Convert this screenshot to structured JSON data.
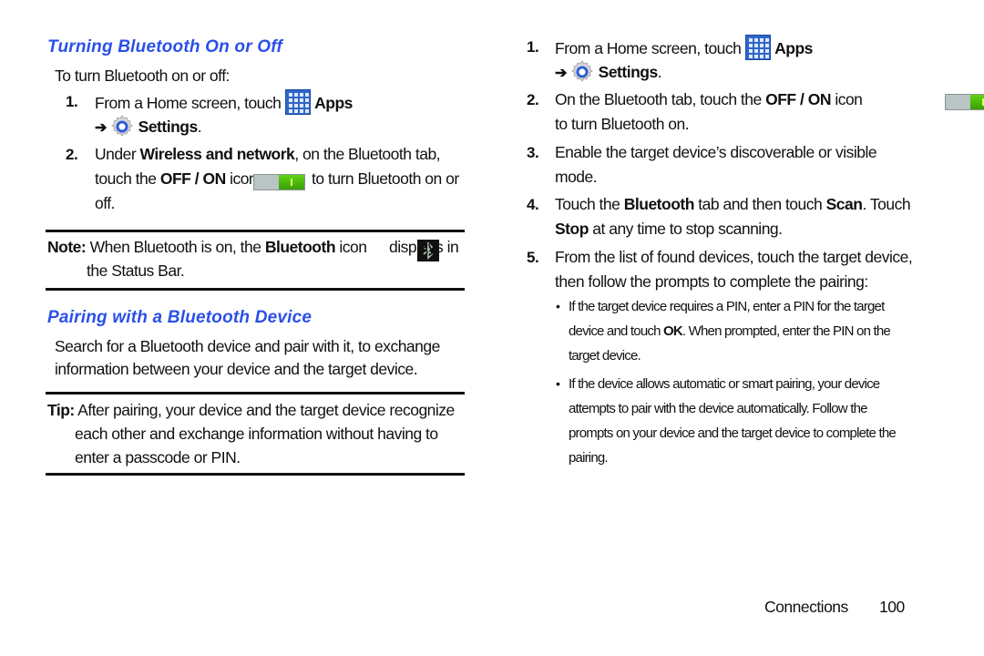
{
  "left": {
    "section1": {
      "title": "Turning Bluetooth On or Off",
      "intro": "To turn Bluetooth on or off:",
      "step1": {
        "num": "1.",
        "text_a": "From a Home screen, touch",
        "apps_label": "Apps",
        "arrow": "➔",
        "settings_label": "Settings",
        "period": "."
      },
      "step2": {
        "num": "2.",
        "text_a": "Under ",
        "bold_a": "Wireless and network",
        "text_b": ", on the Bluetooth tab,",
        "text_c": "touch the ",
        "bold_b": "OFF / ON",
        "text_d": " icon",
        "text_e": "to turn Bluetooth on or",
        "text_f": "off."
      },
      "note": {
        "label": "Note:",
        "text_a": " When Bluetooth is on, the ",
        "bold": "Bluetooth",
        "text_b": " icon",
        "text_c": "displays in",
        "text_d": "the Status Bar."
      }
    },
    "section2": {
      "title": "Pairing with a Bluetooth Device",
      "para_line1": "Search for a Bluetooth device and pair with it, to exchange",
      "para_line2": "information between your device and the target device.",
      "tip": {
        "label": "Tip:",
        "line1": " After pairing, your device and the target device recognize",
        "line2": "each other and exchange information without having to",
        "line3": "enter a passcode or PIN."
      }
    }
  },
  "right": {
    "step1": {
      "num": "1.",
      "text_a": "From a Home screen, touch",
      "apps_label": "Apps",
      "arrow": "➔",
      "settings_label": "Settings",
      "period": "."
    },
    "step2": {
      "num": "2.",
      "text_a": "On the Bluetooth tab, touch the ",
      "bold": "OFF / ON",
      "text_b": " icon",
      "text_c": "to turn Bluetooth on."
    },
    "step3": {
      "num": "3.",
      "line1": "Enable the target device’s discoverable or visible",
      "line2": "mode."
    },
    "step4": {
      "num": "4.",
      "text_a": "Touch the ",
      "bold_a": "Bluetooth",
      "text_b": " tab and then touch ",
      "bold_b": "Scan",
      "text_c": ". Touch",
      "bold_c": "Stop",
      "text_d": " at any time to stop scanning."
    },
    "step5": {
      "num": "5.",
      "line1": "From the list of found devices, touch the target device,",
      "line2": "then follow the prompts to complete the pairing:"
    },
    "bullets": [
      {
        "line1": "If the target device requires a PIN, enter a PIN for the target",
        "line2_a": "device and touch ",
        "line2_bold": "OK",
        "line2_b": ". When prompted, enter the PIN on the",
        "line3": "target device."
      },
      {
        "line1": "If the device allows automatic or smart pairing, your device",
        "line2": "attempts to pair with the device automatically. Follow the",
        "line3": "prompts on your device and the target device to complete the",
        "line4": "pairing."
      }
    ],
    "bullet_glyph": "•"
  },
  "footer": {
    "section": "Connections",
    "page": "100"
  },
  "colors": {
    "heading": "#2a50e8",
    "toggle_on": "#4bb80c",
    "apps_icon": "#2f66c8"
  }
}
